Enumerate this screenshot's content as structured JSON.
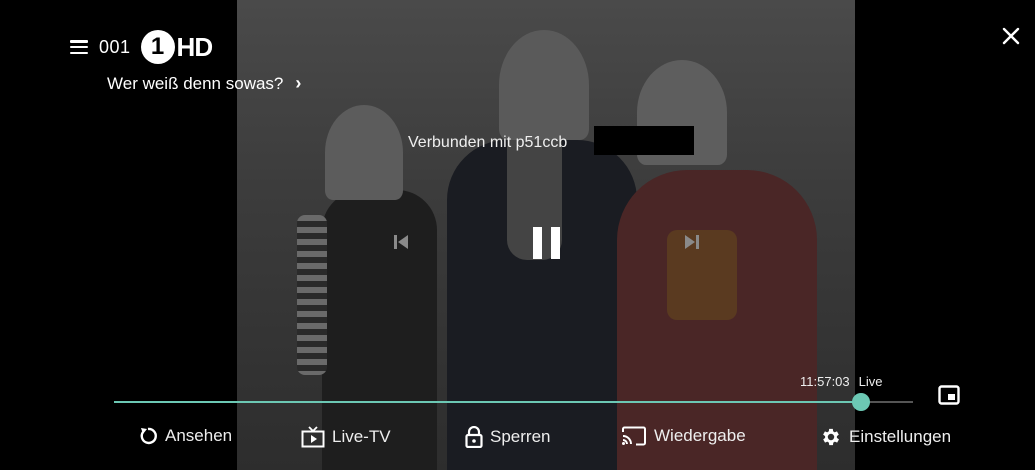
{
  "channel": {
    "number": "001",
    "logo_mark": "1",
    "logo_suffix": "HD",
    "program_title": "Wer weiß denn sowas?",
    "program_chevron": "›"
  },
  "status": {
    "connected_text": "Verbunden mit p51ccb"
  },
  "playback": {
    "time": "11:57:03",
    "live_label": "Live",
    "progress_fraction": 0.935,
    "accent_color": "#6cc8b4"
  },
  "actions": [
    {
      "label": "Ansehen",
      "icon": "replay-icon"
    },
    {
      "label": "Live-TV",
      "icon": "live-tv-icon"
    },
    {
      "label": "Sperren",
      "icon": "lock-icon"
    },
    {
      "label": "Wiedergabe",
      "icon": "cast-icon"
    },
    {
      "label": "Einstellungen",
      "icon": "gear-icon"
    }
  ],
  "icons": {
    "menu": "menu-icon",
    "close": "close-icon",
    "previous": "skip-previous-icon",
    "pause": "pause-icon",
    "next": "skip-next-icon",
    "pip": "picture-in-picture-icon"
  }
}
